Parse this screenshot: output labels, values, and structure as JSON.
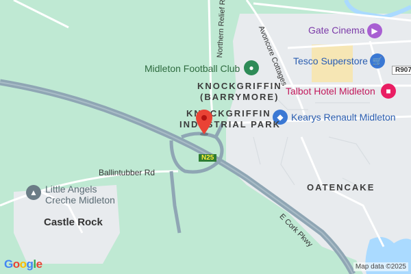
{
  "labels": {
    "gate_cinema": "Gate Cinema",
    "tesco": "Tesco Superstore",
    "talbot": "Talbot Hotel Midleton",
    "kearys": "Kearys Renault Midleton",
    "football": "Midleton Football Club",
    "creche_line1": "Little Angels",
    "creche_line2": "Creche Midleton",
    "knock_barrymore_1": "KNOCKGRIFFIN",
    "knock_barrymore_2": "(BARRYMORE)",
    "knock_industrial_1": "KNOCKGRIFFIN",
    "knock_industrial_2": "INDUSTRIAL PARK",
    "oatencake": "OATENCAKE",
    "castle_rock": "Castle Rock",
    "ballintubber": "Ballintubber Rd",
    "cork_pkwy": "E Cork Pkwy",
    "avoncore": "Avoncore Cottages",
    "northern_relief": "Northern Relief Rd",
    "n25": "N25",
    "r907": "R907"
  },
  "branding": {
    "google": "Google",
    "attribution": "Map data ©2025"
  },
  "icons": {
    "gate_cinema": "film-icon",
    "tesco": "shopping-cart-icon",
    "talbot": "bed-icon",
    "kearys": "car-icon",
    "football": "stadium-icon",
    "creche": "school-icon",
    "pin": "location-pin-icon"
  },
  "colors": {
    "land": "#bfe9d3",
    "urban": "#e8ebee",
    "road": "#ffffff",
    "motorway": "#8fa6b4",
    "water": "#aadaff",
    "pin": "#ea4335"
  }
}
